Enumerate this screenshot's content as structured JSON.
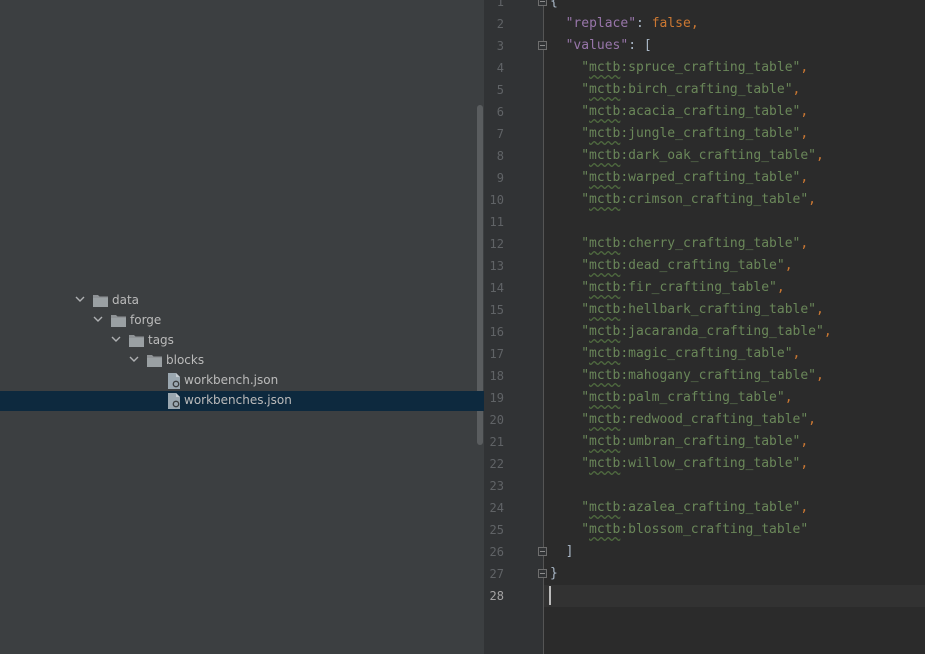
{
  "tree": {
    "items": [
      {
        "label": "data",
        "kind": "folder",
        "expanded": true
      },
      {
        "label": "forge",
        "kind": "folder",
        "expanded": true
      },
      {
        "label": "tags",
        "kind": "folder",
        "expanded": true
      },
      {
        "label": "blocks",
        "kind": "folder",
        "expanded": true
      },
      {
        "label": "workbench.json",
        "kind": "json-file",
        "selected": false
      },
      {
        "label": "workbenches.json",
        "kind": "json-file",
        "selected": true
      }
    ]
  },
  "editor": {
    "current_line": 28,
    "line_numbers": [
      "1",
      "2",
      "3",
      "4",
      "5",
      "6",
      "7",
      "8",
      "9",
      "10",
      "11",
      "12",
      "13",
      "14",
      "15",
      "16",
      "17",
      "18",
      "19",
      "20",
      "21",
      "22",
      "23",
      "24",
      "25",
      "26",
      "27",
      "28"
    ],
    "code": {
      "open_brace": "{",
      "replace_key": "\"replace\"",
      "replace_value": "false",
      "values_key": "\"values\"",
      "open_bracket": "[",
      "close_bracket": "]",
      "close_brace": "}",
      "entries": [
        {
          "ns": "mctb",
          "name": "spruce_crafting_table",
          "comma": true
        },
        {
          "ns": "mctb",
          "name": "birch_crafting_table",
          "comma": true
        },
        {
          "ns": "mctb",
          "name": "acacia_crafting_table",
          "comma": true
        },
        {
          "ns": "mctb",
          "name": "jungle_crafting_table",
          "comma": true
        },
        {
          "ns": "mctb",
          "name": "dark_oak_crafting_table",
          "comma": true
        },
        {
          "ns": "mctb",
          "name": "warped_crafting_table",
          "comma": true
        },
        {
          "ns": "mctb",
          "name": "crimson_crafting_table",
          "comma": true
        },
        null,
        {
          "ns": "mctb",
          "name": "cherry_crafting_table",
          "comma": true
        },
        {
          "ns": "mctb",
          "name": "dead_crafting_table",
          "comma": true
        },
        {
          "ns": "mctb",
          "name": "fir_crafting_table",
          "comma": true
        },
        {
          "ns": "mctb",
          "name": "hellbark_crafting_table",
          "comma": true
        },
        {
          "ns": "mctb",
          "name": "jacaranda_crafting_table",
          "comma": true
        },
        {
          "ns": "mctb",
          "name": "magic_crafting_table",
          "comma": true
        },
        {
          "ns": "mctb",
          "name": "mahogany_crafting_table",
          "comma": true
        },
        {
          "ns": "mctb",
          "name": "palm_crafting_table",
          "comma": true
        },
        {
          "ns": "mctb",
          "name": "redwood_crafting_table",
          "comma": true
        },
        {
          "ns": "mctb",
          "name": "umbran_crafting_table",
          "comma": true
        },
        {
          "ns": "mctb",
          "name": "willow_crafting_table",
          "comma": true
        },
        null,
        {
          "ns": "mctb",
          "name": "azalea_crafting_table",
          "comma": true
        },
        {
          "ns": "mctb",
          "name": "blossom_crafting_table",
          "comma": false
        }
      ]
    }
  },
  "colors": {
    "panel": "#3c3f41",
    "editor_bg": "#2b2b2b",
    "selection": "#0d293e",
    "keyword": "#9876aa",
    "string": "#6a8759",
    "boolean": "#cc7832"
  }
}
